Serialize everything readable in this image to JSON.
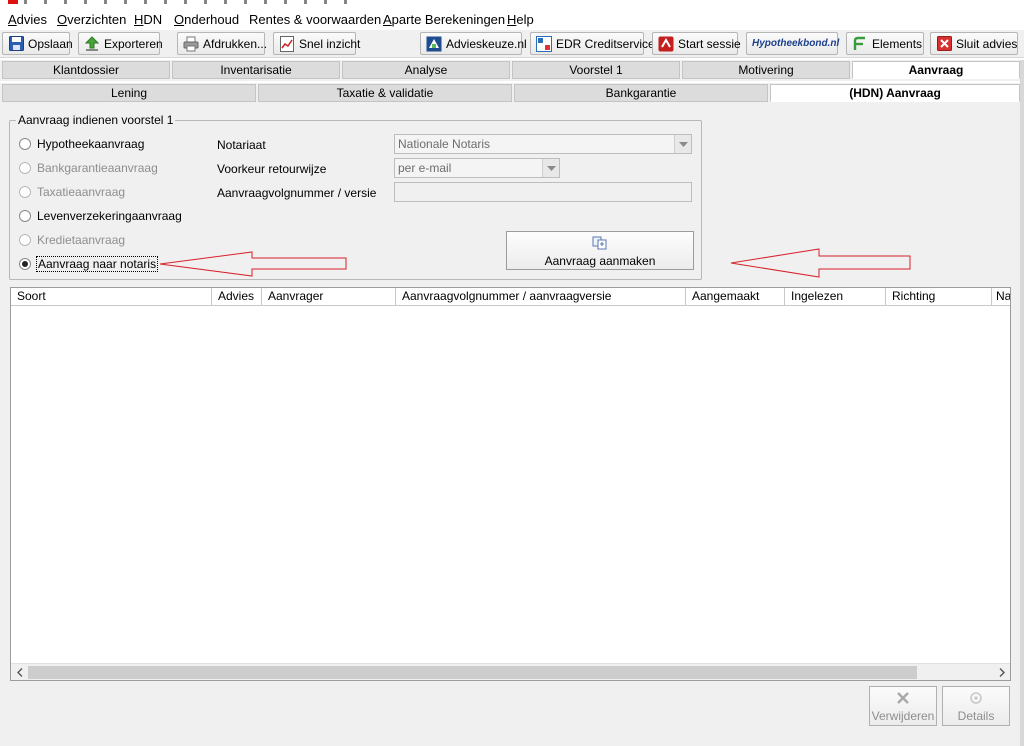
{
  "menu": [
    {
      "label": "Advies",
      "ul": "A",
      "rest": "dvies"
    },
    {
      "label": "Overzichten",
      "ul": "O",
      "rest": "verzichten"
    },
    {
      "label": "HDN",
      "ul": "H",
      "rest": "DN"
    },
    {
      "label": "Onderhoud",
      "ul": "O",
      "rest": "nderhoud"
    },
    {
      "label": "Rentes & voorwaarden",
      "ul": "",
      "rest": "Rentes & voorwaarden"
    },
    {
      "label": "Aparte Berekeningen",
      "ul": "A",
      "rest": "parte Berekeningen"
    },
    {
      "label": "Help",
      "ul": "H",
      "rest": "elp"
    }
  ],
  "toolbar": {
    "save": "Opslaan",
    "export": "Exporteren",
    "print": "Afdrukken...",
    "quick_view": "Snel inzicht",
    "advieskeuze": "Advieskeuze.nl",
    "edr": "EDR Creditservice",
    "start_session": "Start sessie",
    "hypotheekbond": "Hypotheekbond.nl",
    "elements": "Elements",
    "close_advice": "Sluit advies"
  },
  "main_tabs": [
    "Klantdossier",
    "Inventarisatie",
    "Analyse",
    "Voorstel 1",
    "Motivering",
    "Aanvraag"
  ],
  "sub_tabs": [
    "Lening",
    "Taxatie & validatie",
    "Bankgarantie",
    "(HDN) Aanvraag"
  ],
  "group": {
    "title": "Aanvraag indienen voorstel 1",
    "radios": [
      {
        "label": "Hypotheekaanvraag",
        "enabled": true,
        "checked": false
      },
      {
        "label": "Bankgarantieaanvraag",
        "enabled": false,
        "checked": false
      },
      {
        "label": "Taxatieaanvraag",
        "enabled": false,
        "checked": false
      },
      {
        "label": "Levenverzekeringaanvraag",
        "enabled": true,
        "checked": false
      },
      {
        "label": "Kredietaanvraag",
        "enabled": false,
        "checked": false
      },
      {
        "label": "Aanvraag naar notaris",
        "enabled": true,
        "checked": true
      }
    ],
    "notariaat_label": "Notariaat",
    "notariaat_value": "Nationale Notaris",
    "retour_label": "Voorkeur retourwijze",
    "retour_value": "per e-mail",
    "volgnummer_label": "Aanvraagvolgnummer / versie",
    "create_button": "Aanvraag aanmaken"
  },
  "table": {
    "columns": [
      "Soort",
      "Advies",
      "Aanvrager",
      "Aanvraagvolgnummer / aanvraagversie",
      "Aangemaakt",
      "Ingelezen",
      "Richting",
      "Na"
    ]
  },
  "bottom": {
    "delete": "Verwijderen",
    "details": "Details"
  },
  "colors": {
    "tab_active_bg": "#ffffff",
    "tab_bg": "#dcdcdc",
    "panel_bg": "#f0f0f0",
    "annotation_arrow": "#d8202a",
    "disabled_text": "#8e8e8e"
  }
}
